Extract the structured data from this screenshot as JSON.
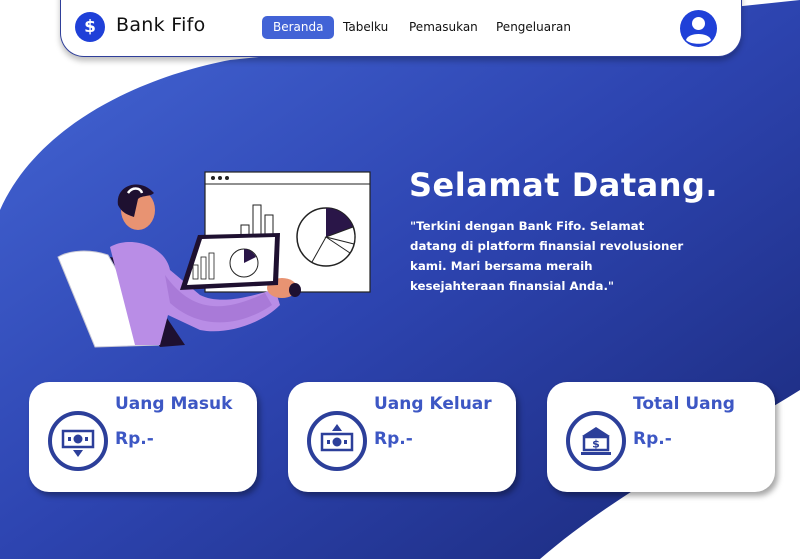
{
  "navbar": {
    "logo_symbol": "$",
    "brand": "Bank Fifo",
    "links": [
      {
        "label": "Beranda",
        "active": true
      },
      {
        "label": "Tabelku",
        "active": false
      },
      {
        "label": "Pemasukan",
        "active": false
      },
      {
        "label": "Pengeluaran",
        "active": false
      }
    ],
    "user_icon": "user-circle-icon"
  },
  "hero": {
    "title": "Selamat Datang.",
    "text": "\"Terkini dengan Bank Fifo. Selamat datang di platform finansial revolusioner kami. Mari bersama meraih kesejahteraan finansial Anda.\"",
    "illustration": "person-analytics-illustration"
  },
  "cards": [
    {
      "title": "Uang Masuk",
      "value": "Rp.-",
      "icon": "money-in-icon"
    },
    {
      "title": "Uang Keluar",
      "value": "Rp.-",
      "icon": "money-out-icon"
    },
    {
      "title": "Total Uang",
      "value": "Rp.-",
      "icon": "bank-icon"
    }
  ],
  "colors": {
    "accent": "#4263d6",
    "brand_blue": "#1f40d8",
    "gradient_start": "#3f5fd0",
    "gradient_end": "#1a2878",
    "card_text": "#3d57c4"
  }
}
